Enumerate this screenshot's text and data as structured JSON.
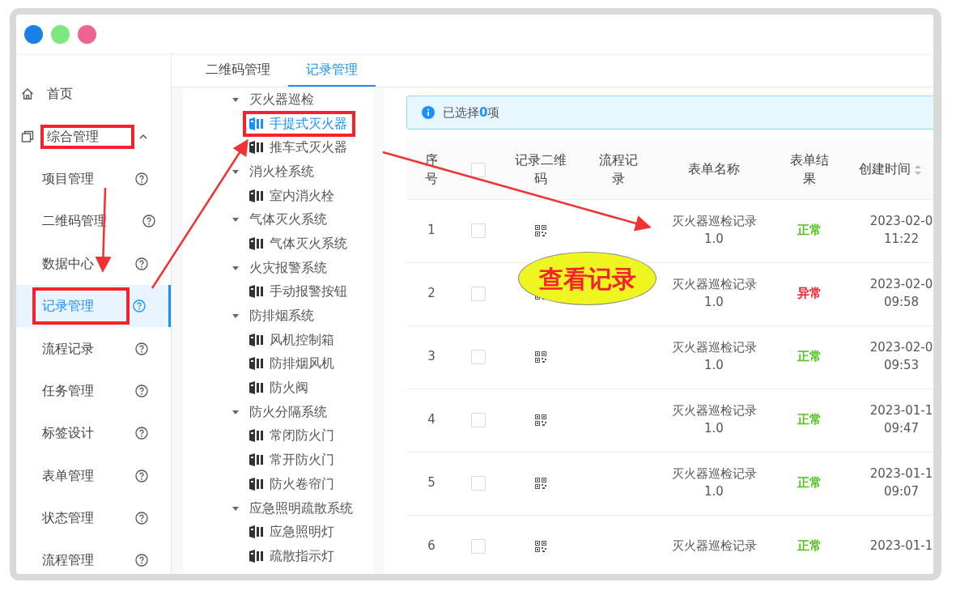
{
  "window": {
    "dots": [
      {
        "color": "#1a7fe6"
      },
      {
        "color": "#7ee87e"
      },
      {
        "color": "#f06292"
      }
    ]
  },
  "sidebar": {
    "items": [
      {
        "kind": "link",
        "label": "首页"
      },
      {
        "kind": "group",
        "label": "综合管理",
        "expanded": true,
        "highlighted": true,
        "children": [
          {
            "label": "项目管理",
            "selected": false,
            "highlighted": false
          },
          {
            "label": "二维码管理",
            "selected": false,
            "highlighted": false
          },
          {
            "label": "数据中心",
            "selected": false,
            "highlighted": false
          },
          {
            "label": "记录管理",
            "selected": true,
            "highlighted": true
          },
          {
            "label": "流程记录",
            "selected": false,
            "highlighted": false
          },
          {
            "label": "任务管理",
            "selected": false,
            "highlighted": false
          },
          {
            "label": "标签设计",
            "selected": false,
            "highlighted": false
          },
          {
            "label": "表单管理",
            "selected": false,
            "highlighted": false
          },
          {
            "label": "状态管理",
            "selected": false,
            "highlighted": false
          },
          {
            "label": "流程管理",
            "selected": false,
            "highlighted": false
          }
        ]
      }
    ]
  },
  "tabs": [
    {
      "label": "二维码管理",
      "selected": false
    },
    {
      "label": "记录管理",
      "selected": true
    }
  ],
  "tree": [
    {
      "label": "灭火器巡检",
      "expanded": true,
      "children": [
        {
          "label": "手提式灭火器",
          "selected": true,
          "highlighted": true
        },
        {
          "label": "推车式灭火器",
          "selected": false,
          "highlighted": false
        }
      ]
    },
    {
      "label": "消火栓系统",
      "expanded": true,
      "children": [
        {
          "label": "室内消火栓",
          "selected": false,
          "highlighted": false
        }
      ]
    },
    {
      "label": "气体灭火系统",
      "expanded": true,
      "children": [
        {
          "label": "气体灭火系统",
          "selected": false,
          "highlighted": false
        }
      ]
    },
    {
      "label": "火灾报警系统",
      "expanded": true,
      "children": [
        {
          "label": "手动报警按钮",
          "selected": false,
          "highlighted": false
        }
      ]
    },
    {
      "label": "防排烟系统",
      "expanded": true,
      "children": [
        {
          "label": "风机控制箱",
          "selected": false,
          "highlighted": false
        },
        {
          "label": "防排烟风机",
          "selected": false,
          "highlighted": false
        },
        {
          "label": "防火阀",
          "selected": false,
          "highlighted": false
        }
      ]
    },
    {
      "label": "防火分隔系统",
      "expanded": true,
      "children": [
        {
          "label": "常闭防火门",
          "selected": false,
          "highlighted": false
        },
        {
          "label": "常开防火门",
          "selected": false,
          "highlighted": false
        },
        {
          "label": "防火卷帘门",
          "selected": false,
          "highlighted": false
        }
      ]
    },
    {
      "label": "应急照明疏散系统",
      "expanded": true,
      "children": [
        {
          "label": "应急照明灯",
          "selected": false,
          "highlighted": false
        },
        {
          "label": "疏散指示灯",
          "selected": false,
          "highlighted": false
        }
      ]
    }
  ],
  "alert": {
    "text": "已选择**0**项"
  },
  "table": {
    "columns": [
      {
        "kind": "text",
        "label": "序号"
      },
      {
        "kind": "checkbox",
        "checked": false
      },
      {
        "kind": "text",
        "label": "记录二维码"
      },
      {
        "kind": "text",
        "label": "流程记录"
      },
      {
        "kind": "text",
        "label": "表单名称"
      },
      {
        "kind": "text",
        "label": "表单结果"
      },
      {
        "kind": "sort",
        "label": "创建时间"
      }
    ],
    "rows": [
      {
        "seq": "1",
        "checked": false,
        "name": "灭火器巡检记录",
        "version": "1.0",
        "result": "正常",
        "color": "#52c41a",
        "date": "2023-02-0",
        "time": "11:22"
      },
      {
        "seq": "2",
        "checked": false,
        "name": "灭火器巡检记录",
        "version": "1.0",
        "result": "异常",
        "color": "#f5222d",
        "date": "2023-02-0",
        "time": "09:58"
      },
      {
        "seq": "3",
        "checked": false,
        "name": "灭火器巡检记录",
        "version": "1.0",
        "result": "正常",
        "color": "#52c41a",
        "date": "2023-02-0",
        "time": "09:53"
      },
      {
        "seq": "4",
        "checked": false,
        "name": "灭火器巡检记录",
        "version": "1.0",
        "result": "正常",
        "color": "#52c41a",
        "date": "2023-01-1",
        "time": "09:47"
      },
      {
        "seq": "5",
        "checked": false,
        "name": "灭火器巡检记录",
        "version": "1.0",
        "result": "正常",
        "color": "#52c41a",
        "date": "2023-01-1",
        "time": "09:07"
      },
      {
        "seq": "6",
        "checked": false,
        "name": "灭火器巡检记录",
        "result": "正常",
        "color": "#52c41a",
        "date": "2023-01-1"
      }
    ]
  },
  "callout": {
    "text": "查看记录"
  }
}
